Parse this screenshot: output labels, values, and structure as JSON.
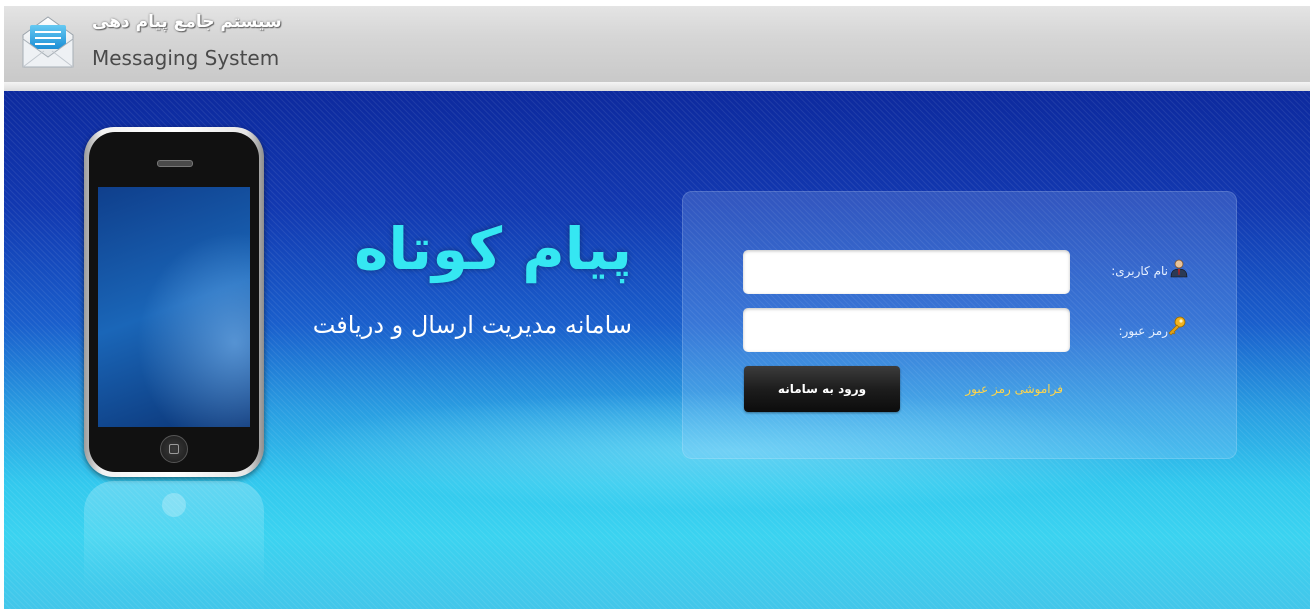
{
  "header": {
    "title_fa": "سیستم جامع پیام دهی",
    "title_en": "Messaging System",
    "logo_icon": "envelope-icon"
  },
  "hero": {
    "brand_title": "پیام کوتاه",
    "brand_subtitle": "سامانه مدیریت ارسال و دریافت"
  },
  "login": {
    "username_label": "نام کاربری:",
    "username_value": "",
    "username_icon": "user-icon",
    "password_label": "رمز عبور:",
    "password_value": "",
    "password_icon": "key-icon",
    "submit_label": "ورود به سامانه",
    "forgot_label": "فراموشی رمز عبور"
  },
  "colors": {
    "brand_cyan": "#35e7f2",
    "forgot_link": "#ffd54a",
    "button_dark": "#1d1d1d"
  }
}
